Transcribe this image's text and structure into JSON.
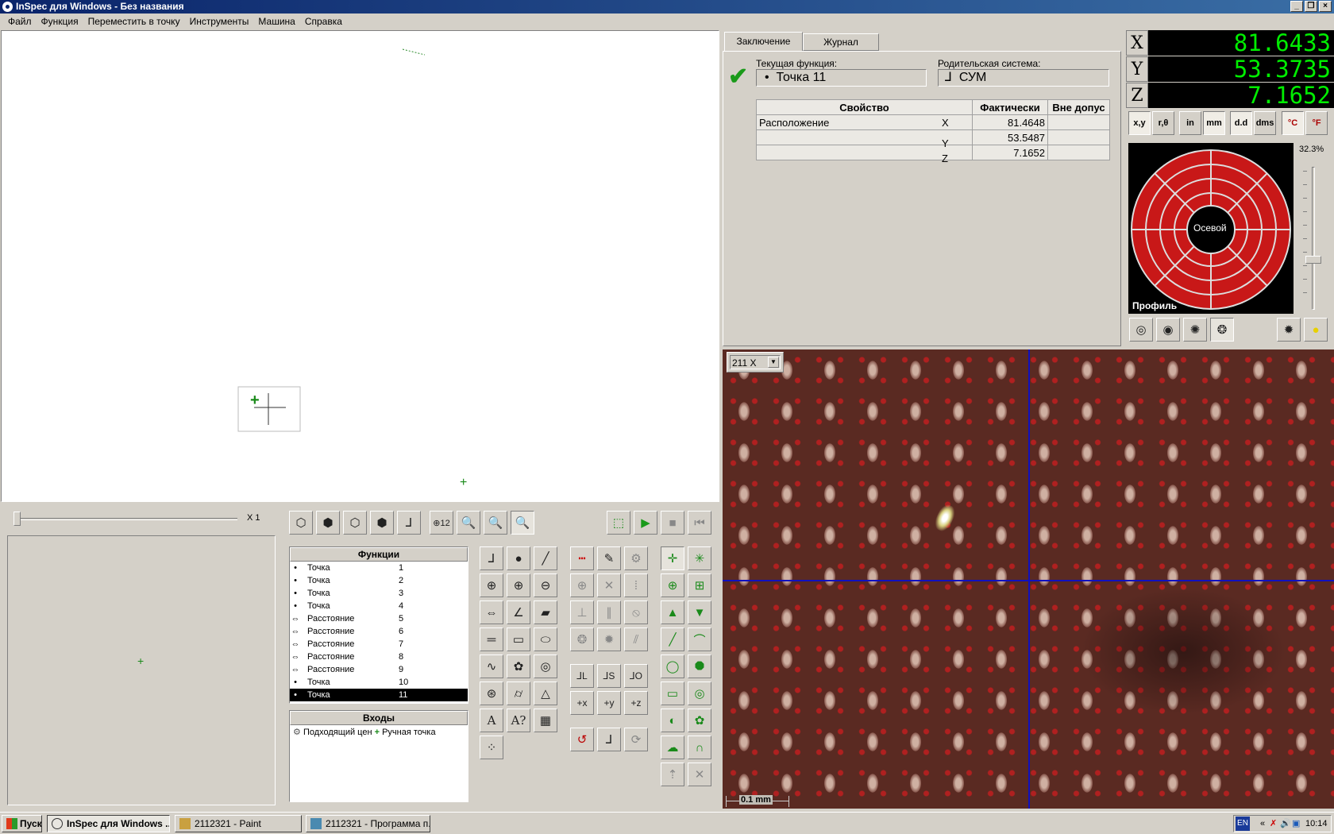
{
  "window": {
    "title": "InSpec для Windows - Без названия"
  },
  "menu": [
    "Файл",
    "Функция",
    "Переместить в точку",
    "Инструменты",
    "Машина",
    "Справка"
  ],
  "zoom_panel": {
    "label": "X 1"
  },
  "tabs": [
    "Заключение",
    "Журнал"
  ],
  "conclusion": {
    "current_function_label": "Текущая функция:",
    "current_function_value": "Точка  11",
    "parent_system_label": "Родительская система:",
    "parent_system_value": "СУМ",
    "table_headers": [
      "Свойство",
      "Фактически",
      "Вне допус"
    ],
    "rows": [
      {
        "property": "Расположение",
        "axis": "X",
        "actual": "81.4648",
        "out": ""
      },
      {
        "property": "",
        "axis": "Y",
        "actual": "53.5487",
        "out": ""
      },
      {
        "property": "",
        "axis": "Z",
        "actual": "7.1652",
        "out": ""
      }
    ]
  },
  "dro": {
    "x_label": "X",
    "x_value": "81.6433",
    "y_label": "Y",
    "y_value": "53.3735",
    "z_label": "Z",
    "z_value": "7.1652"
  },
  "unit_buttons": [
    "x,y",
    "r,θ",
    "in",
    "mm",
    "d.d",
    "dms",
    "°C",
    "°F"
  ],
  "light": {
    "percent": "32.3%",
    "center_label": "Осевой",
    "mode_label": "Профиль"
  },
  "camera": {
    "magnification": "211 X",
    "scale_label": "0.1 mm"
  },
  "features": {
    "header": "Функции",
    "items": [
      {
        "name": "Точка",
        "no": "1",
        "icon": "•"
      },
      {
        "name": "Точка",
        "no": "2",
        "icon": "•"
      },
      {
        "name": "Точка",
        "no": "3",
        "icon": "•"
      },
      {
        "name": "Точка",
        "no": "4",
        "icon": "•"
      },
      {
        "name": "Расстояние",
        "no": "5",
        "icon": "⇔"
      },
      {
        "name": "Расстояние",
        "no": "6",
        "icon": "⇔"
      },
      {
        "name": "Расстояние",
        "no": "7",
        "icon": "⇔"
      },
      {
        "name": "Расстояние",
        "no": "8",
        "icon": "⇔"
      },
      {
        "name": "Расстояние",
        "no": "9",
        "icon": "⇔"
      },
      {
        "name": "Точка",
        "no": "10",
        "icon": "•"
      },
      {
        "name": "Точка",
        "no": "11",
        "icon": "•"
      }
    ]
  },
  "inputs": {
    "header": "Входы",
    "item1": "Подходящий цен",
    "item2": "Ручная точка"
  },
  "taskbar": {
    "start": "Пуск",
    "tasks": [
      "InSpec для Windows ...",
      "2112321 - Paint",
      "2112321 - Программа п..."
    ],
    "lang": "EN",
    "time": "10:14"
  },
  "colors": {
    "title_start": "#0a246a",
    "dro_text": "#00ee00",
    "light_ring": "#c81818"
  }
}
